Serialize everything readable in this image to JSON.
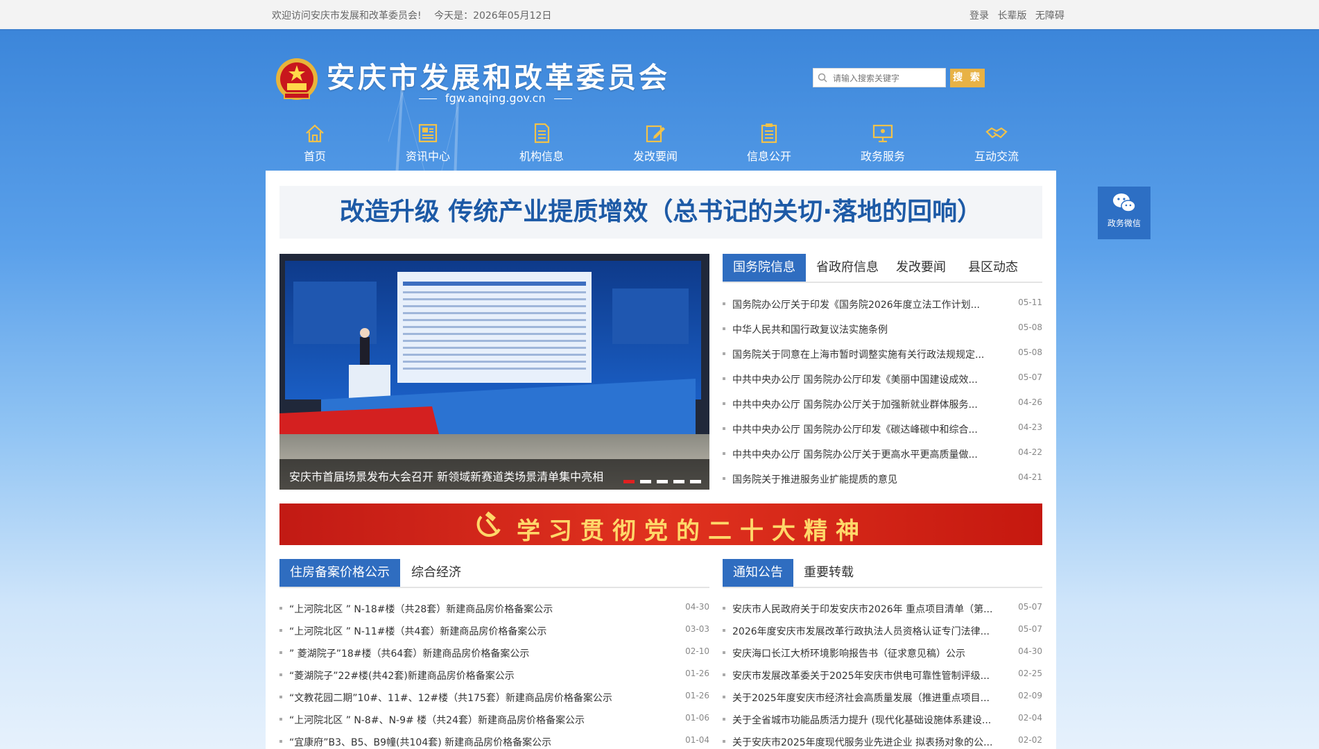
{
  "topbar": {
    "welcome": "欢迎访问安庆市发展和改革委员会!",
    "today": "今天是：2026年05月12日",
    "links": [
      "登录",
      "长辈版",
      "无障碍"
    ]
  },
  "header": {
    "title": "安庆市发展和改革委员会",
    "domain": "fgw.anqing.gov.cn",
    "search_placeholder": "请输入搜索关键字",
    "search_button": "搜 索"
  },
  "nav": [
    {
      "label": "首页",
      "icon": "home-icon"
    },
    {
      "label": "资讯中心",
      "icon": "newspaper-icon"
    },
    {
      "label": "机构信息",
      "icon": "document-icon"
    },
    {
      "label": "发改要闻",
      "icon": "edit-icon"
    },
    {
      "label": "信息公开",
      "icon": "clipboard-icon"
    },
    {
      "label": "政务服务",
      "icon": "monitor-icon"
    },
    {
      "label": "互动交流",
      "icon": "handshake-icon"
    }
  ],
  "headline": "改造升级 传统产业提质增效（总书记的关切·落地的回响）",
  "slider": {
    "caption": "安庆市首届场景发布大会召开 新领域新赛道类场景清单集中亮相",
    "slide_count": 5,
    "active_index": 0
  },
  "news_tabs": [
    "国务院信息",
    "省政府信息",
    "发改要闻",
    "县区动态"
  ],
  "news": [
    {
      "title": "国务院办公厅关于印发《国务院2026年度立法工作计划...",
      "date": "05-11"
    },
    {
      "title": "中华人民共和国行政复议法实施条例",
      "date": "05-08"
    },
    {
      "title": "国务院关于同意在上海市暂时调整实施有关行政法规规定...",
      "date": "05-08"
    },
    {
      "title": "中共中央办公厅 国务院办公厅印发《美丽中国建设成效...",
      "date": "05-07"
    },
    {
      "title": "中共中央办公厅 国务院办公厅关于加强新就业群体服务...",
      "date": "04-26"
    },
    {
      "title": "中共中央办公厅 国务院办公厅印发《碳达峰碳中和综合...",
      "date": "04-23"
    },
    {
      "title": "中共中央办公厅 国务院办公厅关于更高水平更高质量做...",
      "date": "04-22"
    },
    {
      "title": "国务院关于推进服务业扩能提质的意见",
      "date": "04-21"
    }
  ],
  "banner": "学习贯彻党的二十大精神",
  "housing_tabs": [
    "住房备案价格公示",
    "综合经济"
  ],
  "housing": [
    {
      "title": "“上河院北区 ” N-18#楼（共28套）新建商品房价格备案公示",
      "date": "04-30"
    },
    {
      "title": "“上河院北区 ” N-11#楼（共4套）新建商品房价格备案公示",
      "date": "03-03"
    },
    {
      "title": "” 菱湖院子”18#楼（共64套）新建商品房价格备案公示",
      "date": "02-10"
    },
    {
      "title": "“菱湖院子”22#楼(共42套)新建商品房价格备案公示",
      "date": "01-26"
    },
    {
      "title": "“文教花园二期”10#、11#、12#楼（共175套）新建商品房价格备案公示",
      "date": "01-26"
    },
    {
      "title": "“上河院北区 ” N-8#、N-9# 楼（共24套）新建商品房价格备案公示",
      "date": "01-06"
    },
    {
      "title": "“宜康府”B3、B5、B9幢(共104套) 新建商品房价格备案公示",
      "date": "01-04"
    }
  ],
  "notice_tabs": [
    "通知公告",
    "重要转载"
  ],
  "notices": [
    {
      "title": "安庆市人民政府关于印发安庆市2026年 重点项目清单（第...",
      "date": "05-07"
    },
    {
      "title": "2026年度安庆市发展改革行政执法人员资格认证专门法律...",
      "date": "05-07"
    },
    {
      "title": "安庆海口长江大桥环境影响报告书（征求意见稿）公示",
      "date": "04-30"
    },
    {
      "title": "安庆市发展改革委关于2025年安庆市供电可靠性管制评级...",
      "date": "02-25"
    },
    {
      "title": "关于2025年度安庆市经济社会高质量发展（推进重点项目...",
      "date": "02-09"
    },
    {
      "title": "关于全省城市功能品质活力提升 (现代化基础设施体系建设...",
      "date": "02-04"
    },
    {
      "title": "关于安庆市2025年度现代服务业先进企业 拟表扬对象的公...",
      "date": "02-02"
    }
  ],
  "wechat": {
    "label": "政务微信"
  },
  "colors": {
    "primary": "#2f6dc0",
    "headline": "#1d5aa6",
    "banner_red": "#c21a14",
    "search_button": "#e8b245"
  }
}
